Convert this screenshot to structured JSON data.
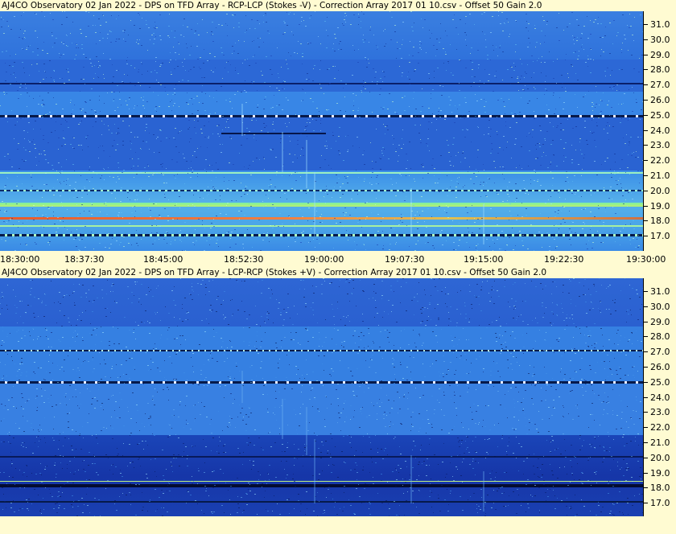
{
  "panels": [
    {
      "title": "AJ4CO Observatory 02 Jan 2022  -  DPS on TFD Array  -  RCP-LCP (Stokes -V)  -  Correction Array 2017 01 10.csv  -  Offset 50  Gain 2.0",
      "y_ticks": [
        "31.0",
        "30.0",
        "29.0",
        "28.0",
        "27.0",
        "26.0",
        "25.0",
        "24.0",
        "23.0",
        "22.0",
        "21.0",
        "20.0",
        "19.0",
        "18.0",
        "17.0"
      ]
    },
    {
      "title": "AJ4CO Observatory 02 Jan 2022  -  DPS on TFD Array  -  LCP-RCP (Stokes +V)  -  Correction Array 2017 01 10.csv  -  Offset 50  Gain 2.0",
      "y_ticks": [
        "31.0",
        "30.0",
        "29.0",
        "28.0",
        "27.0",
        "26.0",
        "25.0",
        "24.0",
        "23.0",
        "22.0",
        "21.0",
        "20.0",
        "19.0",
        "18.0",
        "17.0"
      ]
    }
  ],
  "x_ticks": [
    "18:30:00",
    "18:37:30",
    "18:45:00",
    "18:52:30",
    "19:00:00",
    "19:07:30",
    "19:15:00",
    "19:22:30",
    "19:30:00"
  ],
  "colors": {
    "background": "#fffbd2",
    "spectrogram_base": "#2a6bd8"
  }
}
